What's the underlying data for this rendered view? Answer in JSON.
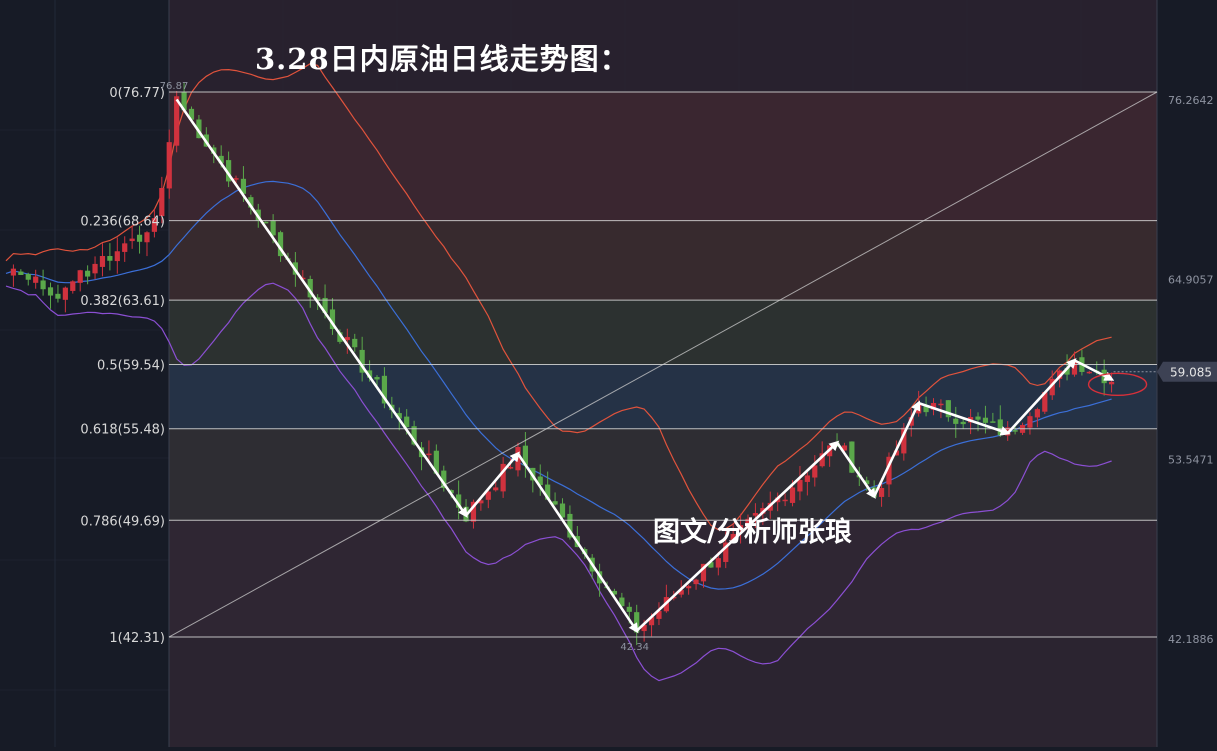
{
  "title": "3.28日内原油日线走势图：",
  "author": "图文/分析师张琅",
  "colors": {
    "background": "#171b26",
    "grid": "#222838",
    "level_line": "#cfcfcf",
    "up": "#d0323e",
    "down": "#5aa84a",
    "upper_band": "#e0533c",
    "mid_band": "#3b6fd8",
    "lower_band": "#8b4fd3",
    "arrow": "#ffffff",
    "circle": "#d8303a"
  },
  "chart_data": {
    "type": "candlestick",
    "fibonacci_levels": [
      {
        "label": "0(76.77)",
        "value": 76.77
      },
      {
        "label": "0.236(68.64)",
        "value": 68.64
      },
      {
        "label": "0.382(63.61)",
        "value": 63.61
      },
      {
        "label": "0.5(59.54)",
        "value": 59.54
      },
      {
        "label": "0.618(55.48)",
        "value": 55.48
      },
      {
        "label": "0.786(49.69)",
        "value": 49.69
      },
      {
        "label": "1(42.31)",
        "value": 42.31
      }
    ],
    "y_axis_ticks": [
      "76.2642",
      "64.9057",
      "53.5471",
      "42.1886"
    ],
    "current_price": "59.085",
    "swing_high_label": "76.87",
    "swing_low_label": "42.34",
    "ylim": [
      40.4,
      78.6
    ],
    "n_bars": 138,
    "trend_path": [
      {
        "bar": 23,
        "price": 76.3
      },
      {
        "bar": 62,
        "price": 50.0
      },
      {
        "bar": 69,
        "price": 53.9
      },
      {
        "bar": 85,
        "price": 42.7
      },
      {
        "bar": 112,
        "price": 54.6
      },
      {
        "bar": 117,
        "price": 51.2
      },
      {
        "bar": 123,
        "price": 57.1
      },
      {
        "bar": 135,
        "price": 55.2
      },
      {
        "bar": 144,
        "price": 59.8
      },
      {
        "bar": 149,
        "price": 58.6
      }
    ]
  }
}
